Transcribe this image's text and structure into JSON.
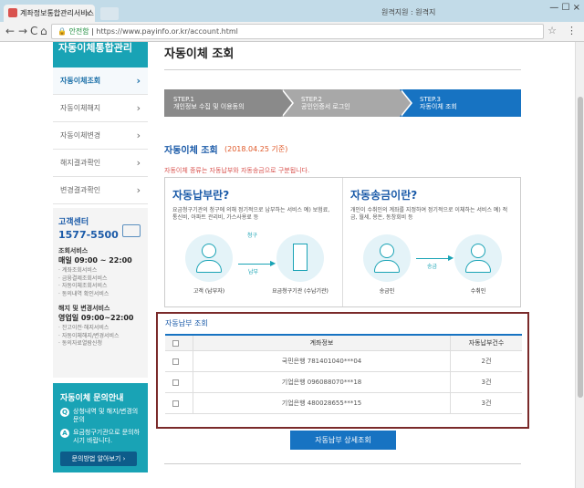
{
  "browser": {
    "tab_title": "계좌정보통합관리서비스",
    "tab_close": "×",
    "remote_tab": "원격지원 : 원격지",
    "window_buttons": "— ☐ ×",
    "back": "←",
    "forward": "→",
    "reload": "C",
    "home": "⌂",
    "url_secure": "🔒 안전함",
    "url": "https://www.payinfo.or.kr/account.html",
    "star": "☆",
    "menu": "⋮"
  },
  "sidebar": {
    "title": "자동이체통합관리",
    "items": [
      {
        "label": "자동이체조회",
        "active": true
      },
      {
        "label": "자동이체해지"
      },
      {
        "label": "자동이체변경"
      },
      {
        "label": "해지결과확인"
      },
      {
        "label": "변경결과확인"
      }
    ],
    "chev": "›"
  },
  "customer_center": {
    "title": "고객센터",
    "phone": "1577-5500",
    "query_service": "조회서비스",
    "query_hours": "매일 09:00 ~ 22:00",
    "query_list": [
      "· 계좌조회서비스",
      "· 금융결제조회서비스",
      "· 자동이체조회서비스",
      "· 동의내역 확인서비스"
    ],
    "change_service": "해지 및 변경서비스",
    "change_hours": "영업일 09:00~22:00",
    "change_list": [
      "· 잔고이전·해지서비스",
      "· 자동이체해지/변경서비스",
      "· 동의자료열람신청"
    ]
  },
  "inquiry": {
    "title": "자동이체 문의안내",
    "items": [
      {
        "badge": "Q",
        "text": "상청내역 및 해지/변경의 문의"
      },
      {
        "badge": "A",
        "text": "요금청구기관으로 문의하시기 바랍니다."
      }
    ],
    "button": "문의방법 알아보기 ›"
  },
  "main": {
    "title": "자동이체 조회",
    "steps": [
      {
        "num": "STEP.1",
        "label": "개인정보 수집 및 이용동의"
      },
      {
        "num": "STEP.2",
        "label": "공인인증서 로그인"
      },
      {
        "num": "STEP.3",
        "label": "자동이체 조회"
      }
    ],
    "section_title": "자동이체 조회",
    "section_date": "(2018.04.25 기준)",
    "note": "자동이체 종류는 자동납부와 자동송금으로 구분됩니다."
  },
  "info": {
    "left": {
      "heading": "자동납부란?",
      "desc": "요금청구기관의 청구에 의해 정기적으로 납부하는 서비스 예) 보험료, 통신비, 아파트 관리비, 가스사용료 등",
      "label_from": "고객 (납부자)",
      "label_to": "요금청구기관 (수납기관)",
      "arrow_top": "청구",
      "arrow_bottom": "납부"
    },
    "right": {
      "heading": "자동송금이란?",
      "desc": "개인이 수취인의 계좌를 지정하여 정기적으로 이체하는 서비스 예) 적금, 월세, 용돈, 동창회비 등",
      "label_from": "송금인",
      "label_to": "수취인",
      "arrow_label": "송금"
    }
  },
  "lookup": {
    "title": "자동납부 조회",
    "col_account": "계좌정보",
    "col_count": "자동납부건수",
    "rows": [
      {
        "account": "국민은행 781401040***04",
        "count": "2건"
      },
      {
        "account": "기업은행 096088070***18",
        "count": "3건"
      },
      {
        "account": "기업은행 480028655***15",
        "count": "3건"
      }
    ]
  },
  "detail_button": "자동납부 상세조회",
  "colors": {
    "brand_teal": "#19a3b5",
    "brand_blue": "#1773c2",
    "highlight_border": "#7a2a2a"
  }
}
